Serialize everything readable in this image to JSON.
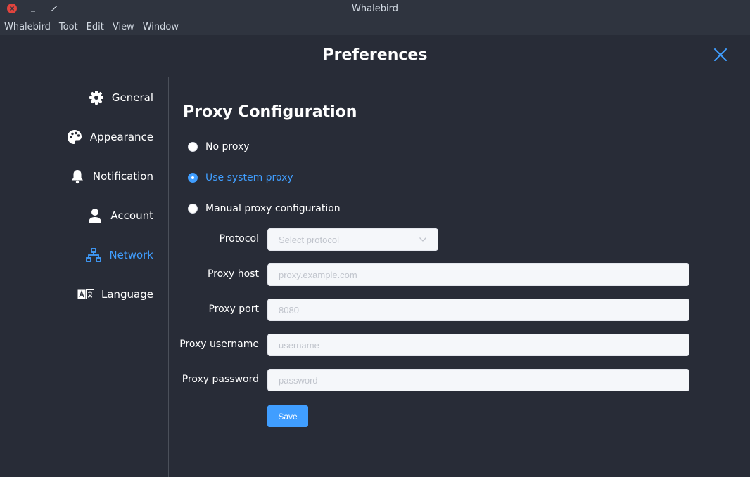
{
  "window": {
    "title": "Whalebird"
  },
  "menubar": {
    "items": [
      "Whalebird",
      "Toot",
      "Edit",
      "View",
      "Window"
    ]
  },
  "header": {
    "title": "Preferences"
  },
  "sidebar": {
    "items": [
      {
        "label": "General",
        "icon": "gear-icon",
        "active": false
      },
      {
        "label": "Appearance",
        "icon": "palette-icon",
        "active": false
      },
      {
        "label": "Notification",
        "icon": "bell-icon",
        "active": false
      },
      {
        "label": "Account",
        "icon": "user-icon",
        "active": false
      },
      {
        "label": "Network",
        "icon": "network-icon",
        "active": true
      },
      {
        "label": "Language",
        "icon": "language-icon",
        "active": false
      }
    ]
  },
  "main": {
    "title": "Proxy Configuration",
    "radios": [
      {
        "label": "No proxy",
        "checked": false
      },
      {
        "label": "Use system proxy",
        "checked": true
      },
      {
        "label": "Manual proxy configuration",
        "checked": false
      }
    ],
    "form": {
      "protocol": {
        "label": "Protocol",
        "placeholder": "Select protocol"
      },
      "host": {
        "label": "Proxy host",
        "placeholder": "proxy.example.com"
      },
      "port": {
        "label": "Proxy port",
        "placeholder": "8080"
      },
      "username": {
        "label": "Proxy username",
        "placeholder": "username"
      },
      "password": {
        "label": "Proxy password",
        "placeholder": "password"
      }
    },
    "save_label": "Save"
  },
  "colors": {
    "accent": "#409eff",
    "background": "#282c37",
    "close_button": "#e0443e"
  }
}
